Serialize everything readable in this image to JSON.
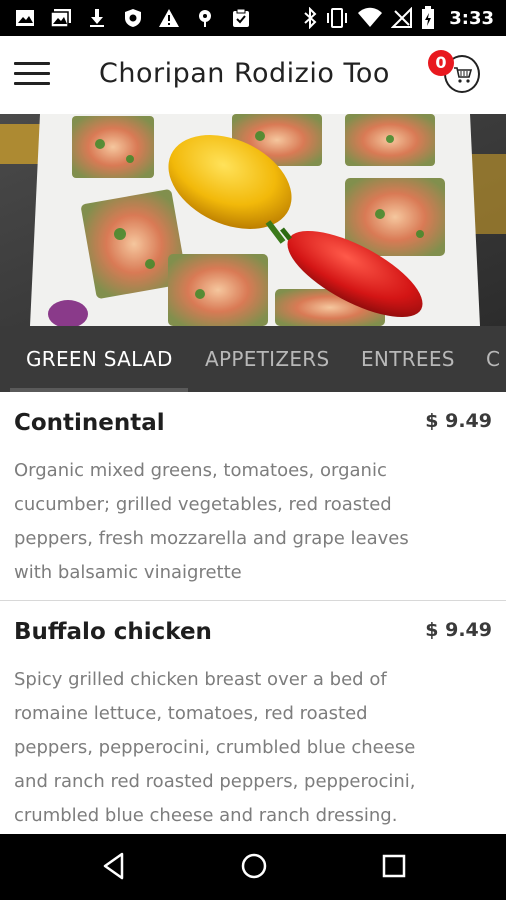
{
  "status_bar": {
    "time": "3:33",
    "left_icons": [
      "image-icon",
      "gallery-icon",
      "download-icon",
      "shield-icon",
      "warning-icon",
      "location-icon",
      "clipboard-icon"
    ],
    "right_icons": [
      "bluetooth-icon",
      "vibrate-icon",
      "wifi-icon",
      "no-signal-icon",
      "battery-icon"
    ]
  },
  "app_bar": {
    "title": "Choripan Rodizio Too",
    "cart_count": "0"
  },
  "tabs": [
    {
      "label": "GREEN SALAD",
      "active": true
    },
    {
      "label": "APPETIZERS",
      "active": false
    },
    {
      "label": "ENTREES",
      "active": false
    },
    {
      "label": "C",
      "active": false
    }
  ],
  "menu_items": [
    {
      "name": "Continental",
      "price": "$ 9.49",
      "description": "Organic mixed greens, tomatoes, organic cucumber; grilled vegetables, red roasted peppers, fresh mozzarella and grape leaves with balsamic vinaigrette"
    },
    {
      "name": "Buffalo chicken",
      "price": "$ 9.49",
      "description": "Spicy grilled chicken breast over a bed of romaine lettuce, tomatoes, red roasted peppers, pepperocini, crumbled blue cheese and ranch red roasted peppers, pepperocini, crumbled blue cheese and ranch dressing."
    }
  ],
  "nav_bar": {
    "buttons": [
      "back-icon",
      "home-icon",
      "recents-icon"
    ]
  },
  "colors": {
    "status_bar": "#000000",
    "tab_bar": "#3a3a3a",
    "badge": "#e8191f",
    "price": "#3a3a3a",
    "description": "#7d7d7d"
  }
}
